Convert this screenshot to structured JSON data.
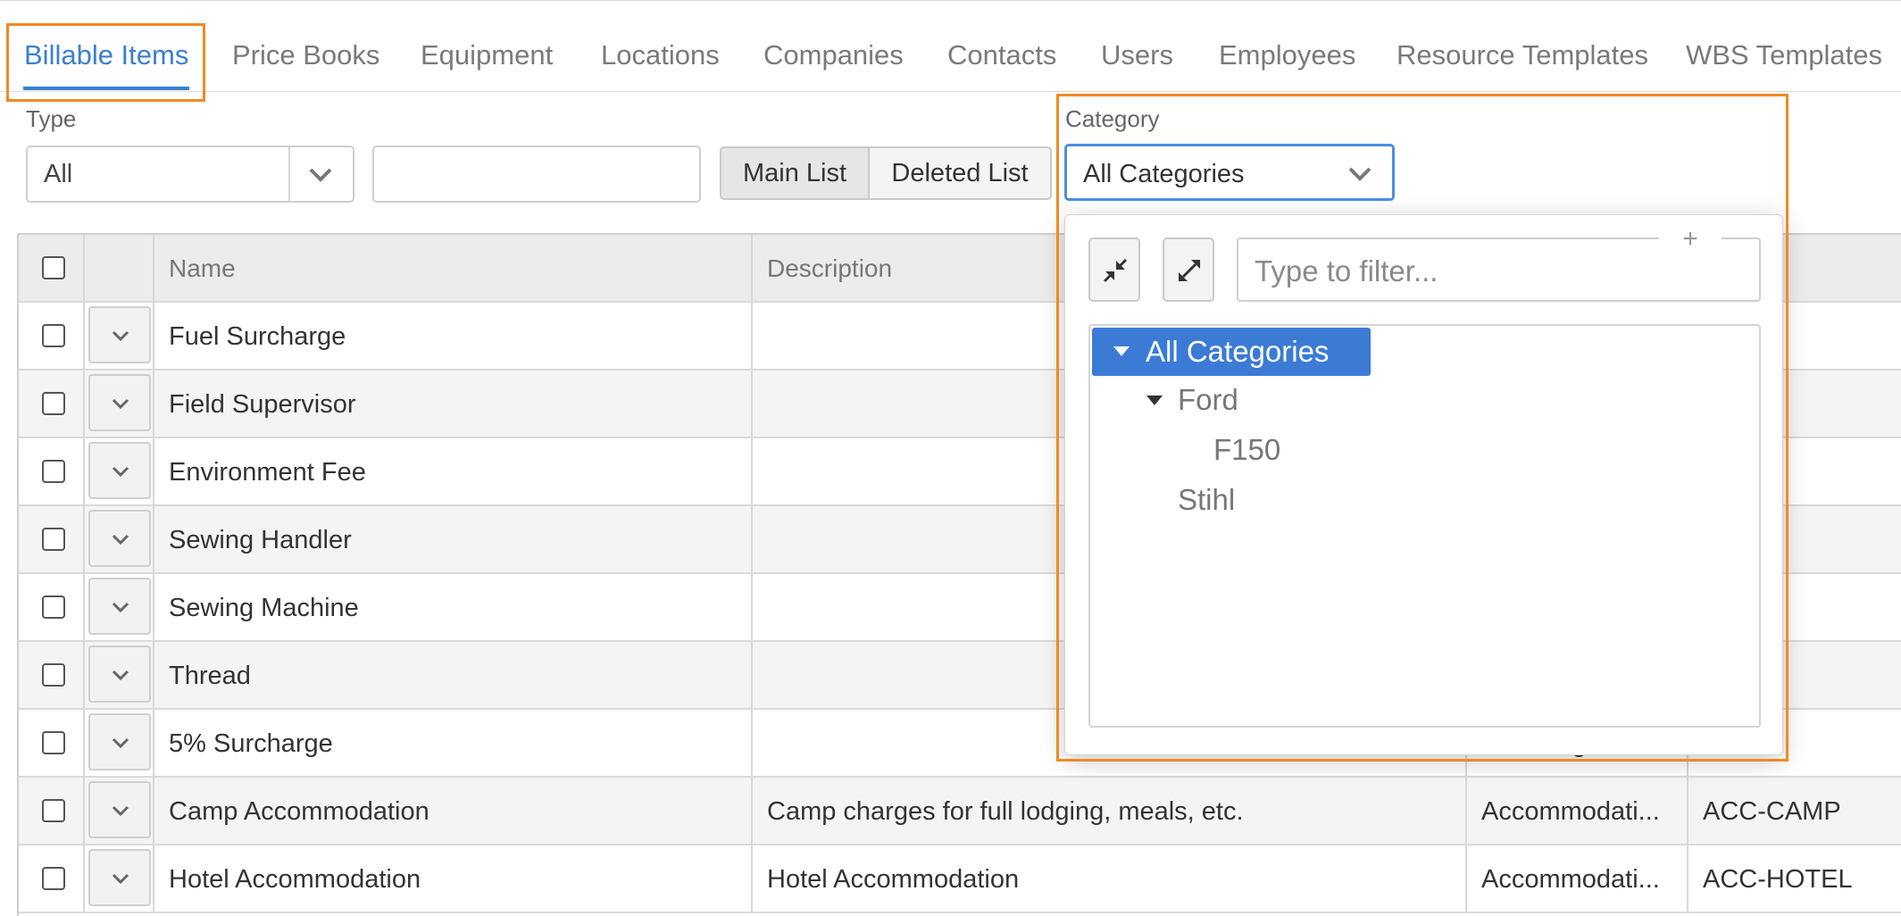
{
  "tabs": [
    {
      "label": "Billable Items",
      "active": true
    },
    {
      "label": "Price Books"
    },
    {
      "label": "Equipment"
    },
    {
      "label": "Locations"
    },
    {
      "label": "Companies"
    },
    {
      "label": "Contacts"
    },
    {
      "label": "Users"
    },
    {
      "label": "Employees"
    },
    {
      "label": "Resource Templates"
    },
    {
      "label": "WBS Templates"
    }
  ],
  "filters": {
    "type_label": "Type",
    "type_value": "All",
    "search_value": "",
    "main_list": "Main List",
    "deleted_list": "Deleted List",
    "category_label": "Category",
    "category_value": "All Categories"
  },
  "category_dropdown": {
    "filter_placeholder": "Type to filter...",
    "add_symbol": "+",
    "tree": {
      "root": "All Categories",
      "ford": "Ford",
      "f150": "F150",
      "stihl": "Stihl"
    }
  },
  "table": {
    "headers": {
      "name": "Name",
      "description": "Description"
    },
    "rows": [
      {
        "name": "Fuel Surcharge",
        "description": "",
        "type": "",
        "code": ""
      },
      {
        "name": "Field Supervisor",
        "description": "",
        "type": "",
        "code": ""
      },
      {
        "name": "Environment Fee",
        "description": "",
        "type": "",
        "code": ""
      },
      {
        "name": "Sewing Handler",
        "description": "",
        "type": "",
        "code": ""
      },
      {
        "name": "Sewing Machine",
        "description": "",
        "type": "",
        "code": ""
      },
      {
        "name": "Thread",
        "description": "",
        "type": "",
        "code": ""
      },
      {
        "name": "5% Surcharge",
        "description": "",
        "type": "Surcharge",
        "code": ""
      },
      {
        "name": "Camp Accommodation",
        "description": "Camp charges for full lodging, meals, etc.",
        "type": "Accommodati...",
        "code": "ACC-CAMP"
      },
      {
        "name": "Hotel Accommodation",
        "description": "Hotel Accommodation",
        "type": "Accommodati...",
        "code": "ACC-HOTEL"
      }
    ]
  },
  "colors": {
    "accent": "#3b7fd1",
    "highlight": "#f08a24",
    "selection": "#3b7bd6"
  }
}
